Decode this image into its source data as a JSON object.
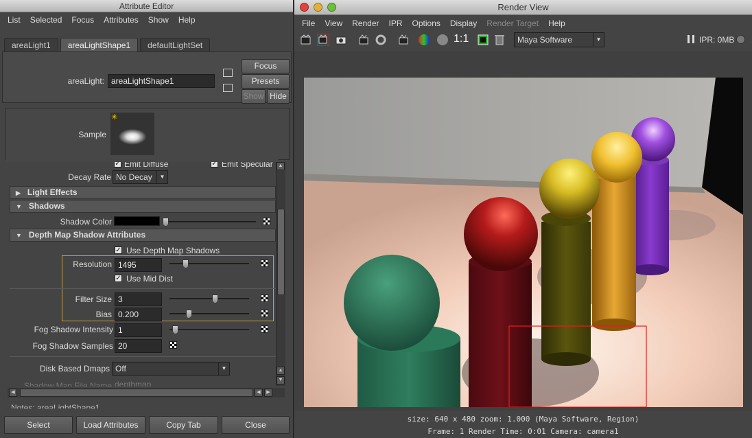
{
  "attribute_editor": {
    "title": "Attribute Editor",
    "menu": [
      "List",
      "Selected",
      "Focus",
      "Attributes",
      "Show",
      "Help"
    ],
    "tabs": [
      "areaLight1",
      "areaLightShape1",
      "defaultLightSet"
    ],
    "active_tab": 1,
    "node_label": "areaLight:",
    "node_value": "areaLightShape1",
    "focus_label": "Focus",
    "presets_label": "Presets",
    "show_label": "Show",
    "hide_label": "Hide",
    "sample_label": "Sample",
    "emit_diffuse": "Emit Diffuse",
    "emit_specular": "Emit Specular",
    "decay_rate_label": "Decay Rate",
    "decay_rate_value": "No Decay",
    "light_effects": "Light Effects",
    "shadows": "Shadows",
    "shadow_color_label": "Shadow Color",
    "depth_map_section": "Depth Map Shadow Attributes",
    "use_depth_map": "Use Depth Map Shadows",
    "resolution_label": "Resolution",
    "resolution_value": "1495",
    "use_mid_dist": "Use Mid Dist",
    "filter_size_label": "Filter Size",
    "filter_size_value": "3",
    "bias_label": "Bias",
    "bias_value": "0.200",
    "fog_intensity_label": "Fog Shadow Intensity",
    "fog_intensity_value": "1",
    "fog_samples_label": "Fog Shadow Samples",
    "fog_samples_value": "20",
    "disk_dmaps_label": "Disk Based Dmaps",
    "disk_dmaps_value": "Off",
    "shadow_file_label": "Shadow Map File Name",
    "shadow_file_value": "depthmap",
    "notes_label": "Notes: areaLightShape1",
    "buttons": {
      "select": "Select",
      "load": "Load Attributes",
      "copy": "Copy Tab",
      "close": "Close"
    },
    "sliders": {
      "shadow_color": 0.0,
      "resolution": 0.18,
      "filter_size": 0.58,
      "bias": 0.22,
      "fog_intensity": 0.04
    }
  },
  "render_view": {
    "title": "Render View",
    "menu": [
      "File",
      "View",
      "Render",
      "IPR",
      "Options",
      "Display",
      "Render Target",
      "Help"
    ],
    "renderer": "Maya Software",
    "ratio_label": "1:1",
    "ipr_label": "IPR: 0MB",
    "status_line1": "size: 640 x 480 zoom: 1.000    (Maya Software, Region)",
    "status_line2": "Frame: 1      Render Time: 0:01      Camera: camera1"
  },
  "colors": {
    "highlight_box": "#c8a040",
    "region_box": "#e02020",
    "close_light": "#e0443c",
    "min_light": "#e0b23c",
    "max_light": "#6cbf3c"
  }
}
